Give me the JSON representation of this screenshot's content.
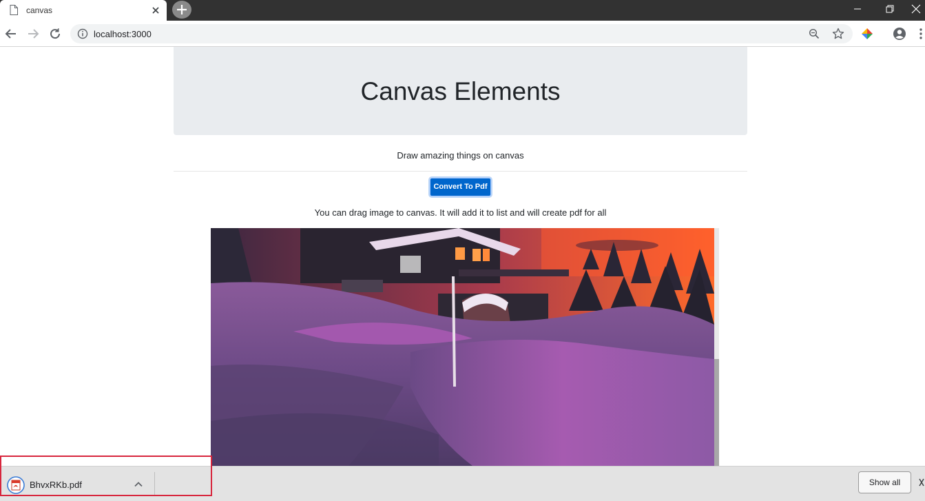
{
  "browser": {
    "tab": {
      "title": "canvas"
    },
    "address": {
      "url": "localhost:3000"
    }
  },
  "page": {
    "heading": "Canvas Elements",
    "subtitle": "Draw amazing things on canvas",
    "convert_button": "Convert To Pdf",
    "hint": "You can drag image to canvas. It will add it to list and will create pdf for all"
  },
  "downloads": {
    "file_name": "BhvxRKb.pdf",
    "show_all": "Show all"
  }
}
